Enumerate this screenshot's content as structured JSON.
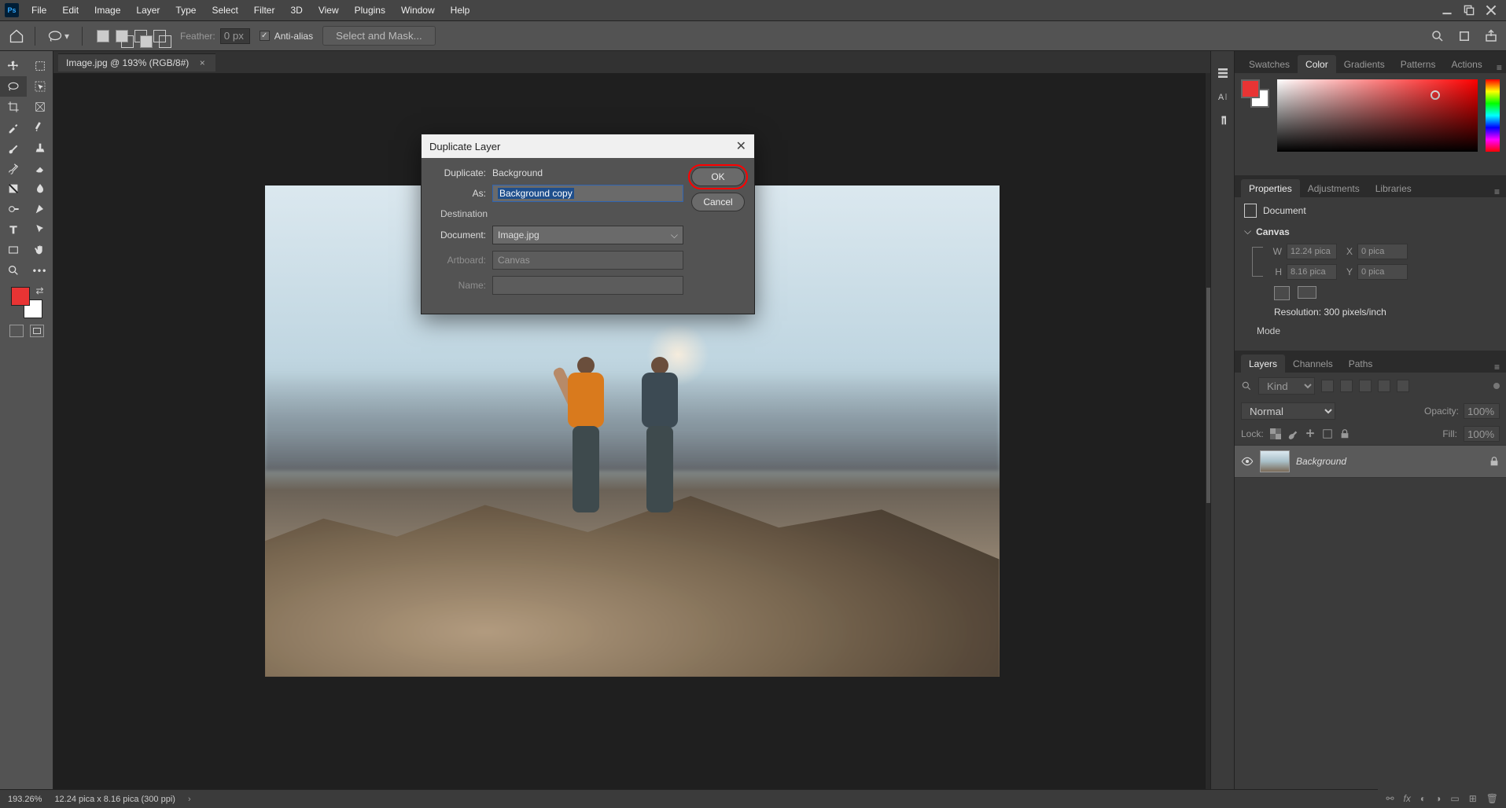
{
  "app": {
    "logo": "Ps"
  },
  "menubar": [
    "File",
    "Edit",
    "Image",
    "Layer",
    "Type",
    "Select",
    "Filter",
    "3D",
    "View",
    "Plugins",
    "Window",
    "Help"
  ],
  "optionsbar": {
    "feather_label": "Feather:",
    "feather_value": "0 px",
    "antialias_label": "Anti-alias",
    "antialias_checked": true,
    "select_mask": "Select and Mask..."
  },
  "document": {
    "tab_title": "Image.jpg @ 193% (RGB/8#)"
  },
  "dialog": {
    "title": "Duplicate Layer",
    "duplicate_label": "Duplicate:",
    "duplicate_value": "Background",
    "as_label": "As:",
    "as_value": "Background copy",
    "destination_label": "Destination",
    "document_label": "Document:",
    "document_value": "Image.jpg",
    "artboard_label": "Artboard:",
    "artboard_value": "Canvas",
    "name_label": "Name:",
    "name_value": "",
    "ok": "OK",
    "cancel": "Cancel"
  },
  "panels": {
    "swatches": "Swatches",
    "color": "Color",
    "gradients": "Gradients",
    "patterns": "Patterns",
    "actions": "Actions",
    "properties": "Properties",
    "adjustments": "Adjustments",
    "libraries": "Libraries",
    "layers": "Layers",
    "channels": "Channels",
    "paths": "Paths"
  },
  "properties": {
    "doc_label": "Document",
    "canvas_label": "Canvas",
    "W_label": "W",
    "W_value": "12.24 pica",
    "H_label": "H",
    "H_value": "8.16 pica",
    "X_label": "X",
    "X_value": "0 pica",
    "Y_label": "Y",
    "Y_value": "0 pica",
    "resolution": "Resolution: 300 pixels/inch",
    "mode": "Mode"
  },
  "layers": {
    "kind_placeholder": "Kind",
    "blend_mode": "Normal",
    "opacity_label": "Opacity:",
    "opacity_value": "100%",
    "lock_label": "Lock:",
    "fill_label": "Fill:",
    "fill_value": "100%",
    "layer_name": "Background"
  },
  "status": {
    "zoom": "193.26%",
    "dims": "12.24 pica x 8.16 pica (300 ppi)"
  },
  "colors": {
    "foreground": "#e83434",
    "background": "#ffffff"
  }
}
